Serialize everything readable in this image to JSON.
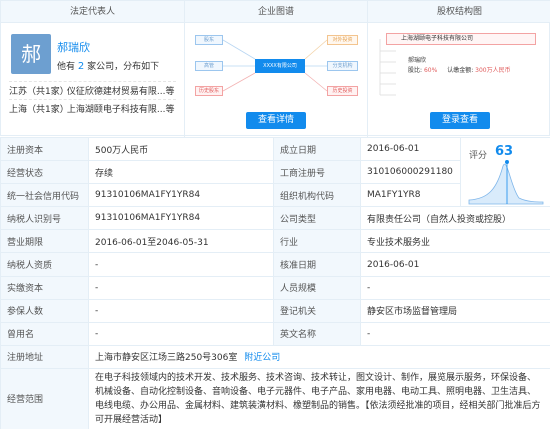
{
  "header": {
    "legal_rep": "法定代表人",
    "graph": "企业图谱",
    "equity": "股权结构图"
  },
  "legal_rep": {
    "avatar_char": "郝",
    "name": "郝瑞欣",
    "sub_prefix": "他有",
    "company_count": "2",
    "sub_suffix": "家公司，分布如下",
    "rows": [
      {
        "location": "江苏（共1家）",
        "company": "仪征欣德建材贸易有限...等"
      },
      {
        "location": "上海（共1家）",
        "company": "上海湖颐电子科技有限...等"
      }
    ]
  },
  "graph": {
    "nodes": [
      "股东",
      "高管",
      "历史股东",
      "对外投资",
      "分支机构",
      "历史投资"
    ],
    "center": "XXXX有限公司",
    "button": "查看详情"
  },
  "equity": {
    "company": "上海湖颐电子科技有限公司",
    "holder": "郝瑞欣",
    "ratio_label": "股比:",
    "ratio": "60%",
    "capital_label": "认缴金额:",
    "capital": "300万人民币",
    "button": "登录查看"
  },
  "table": {
    "rows": [
      [
        "注册资本",
        "500万人民币",
        "成立日期",
        "2016-06-01"
      ],
      [
        "经营状态",
        "存续",
        "工商注册号",
        "310106000291180"
      ],
      [
        "统一社会信用代码",
        "91310106MA1FY1YR84",
        "组织机构代码",
        "MA1FY1YR8"
      ],
      [
        "纳税人识别号",
        "91310106MA1FY1YR84",
        "公司类型",
        "有限责任公司（自然人投资或控股）"
      ],
      [
        "营业期限",
        "2016-06-01至2046-05-31",
        "行业",
        "专业技术服务业"
      ],
      [
        "纳税人资质",
        "-",
        "核准日期",
        "2016-06-01"
      ],
      [
        "实缴资本",
        "-",
        "人员规模",
        "-"
      ],
      [
        "参保人数",
        "-",
        "登记机关",
        "静安区市场监督管理局"
      ],
      [
        "曾用名",
        "-",
        "英文名称",
        "-"
      ]
    ],
    "address_label": "注册地址",
    "address": "上海市静安区江场三路250号306室",
    "address_link": "附近公司",
    "scope_label": "经营范围",
    "scope": "在电子科技领域内的技术开发、技术服务、技术咨询、技术转让，图文设计、制作，展览展示服务，环保设备、机械设备、自动化控制设备、音响设备、电子元器件、电子产品、家用电器、电动工具、照明电器、卫生洁具、电线电缆、办公用品、金属材料、建筑装潢材料、橡塑制品的销售。【依法须经批准的项目，经相关部门批准后方可开展经营活动】"
  },
  "score": {
    "label": "评分",
    "value": "63"
  },
  "colors": {
    "accent": "#128bed",
    "header_bg": "#f2f8fd",
    "border": "#e4eef6"
  }
}
